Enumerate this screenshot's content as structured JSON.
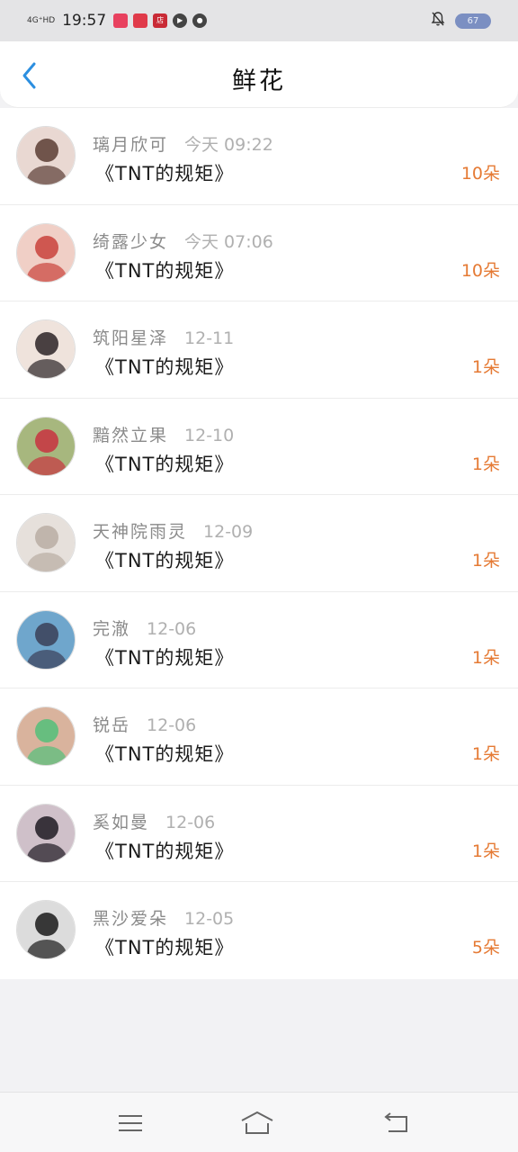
{
  "status": {
    "network": "4G⁺HD",
    "time": "19:57",
    "battery": "67",
    "app_badges": [
      {
        "label": "",
        "color": "#e8415f"
      },
      {
        "label": "",
        "color": "#e03a4a"
      },
      {
        "label": "店",
        "color": "#c92a36"
      },
      {
        "label": "▶",
        "color": "#444444"
      },
      {
        "label": "●",
        "color": "#444444"
      }
    ]
  },
  "header": {
    "title": "鲜花"
  },
  "rows": [
    {
      "name": "璃月欣可",
      "time": "今天 09:22",
      "gift": "《TNT的规矩》",
      "count": "10朵",
      "avatar_colors": [
        "#e9d8d2",
        "#5a3d34"
      ]
    },
    {
      "name": "绮露少女",
      "time": "今天 07:06",
      "gift": "《TNT的规矩》",
      "count": "10朵",
      "avatar_colors": [
        "#f0cfc6",
        "#c9423b"
      ]
    },
    {
      "name": "筑阳星泽",
      "time": "12-11",
      "gift": "《TNT的规矩》",
      "count": "1朵",
      "avatar_colors": [
        "#efe3dc",
        "#2b2326"
      ]
    },
    {
      "name": "黯然立果",
      "time": "12-10",
      "gift": "《TNT的规矩》",
      "count": "1朵",
      "avatar_colors": [
        "#a7b77e",
        "#c83340"
      ]
    },
    {
      "name": "天神院雨灵",
      "time": "12-09",
      "gift": "《TNT的规矩》",
      "count": "1朵",
      "avatar_colors": [
        "#e6e0db",
        "#b8ada3"
      ]
    },
    {
      "name": "完澈",
      "time": "12-06",
      "gift": "《TNT的规矩》",
      "count": "1朵",
      "avatar_colors": [
        "#6fa6cc",
        "#3b3f57"
      ]
    },
    {
      "name": "锐岳",
      "time": "12-06",
      "gift": "《TNT的规矩》",
      "count": "1朵",
      "avatar_colors": [
        "#d9b39d",
        "#52c07a"
      ]
    },
    {
      "name": "奚如曼",
      "time": "12-06",
      "gift": "《TNT的规矩》",
      "count": "1朵",
      "avatar_colors": [
        "#cfc0c9",
        "#1e1a22"
      ]
    },
    {
      "name": "黑沙爱朵",
      "time": "12-05",
      "gift": "《TNT的规矩》",
      "count": "5朵",
      "avatar_colors": [
        "#dcdcdc",
        "#1a1a1a"
      ]
    }
  ],
  "nav": {
    "icons": [
      "menu-icon",
      "home-icon",
      "back-icon"
    ]
  }
}
